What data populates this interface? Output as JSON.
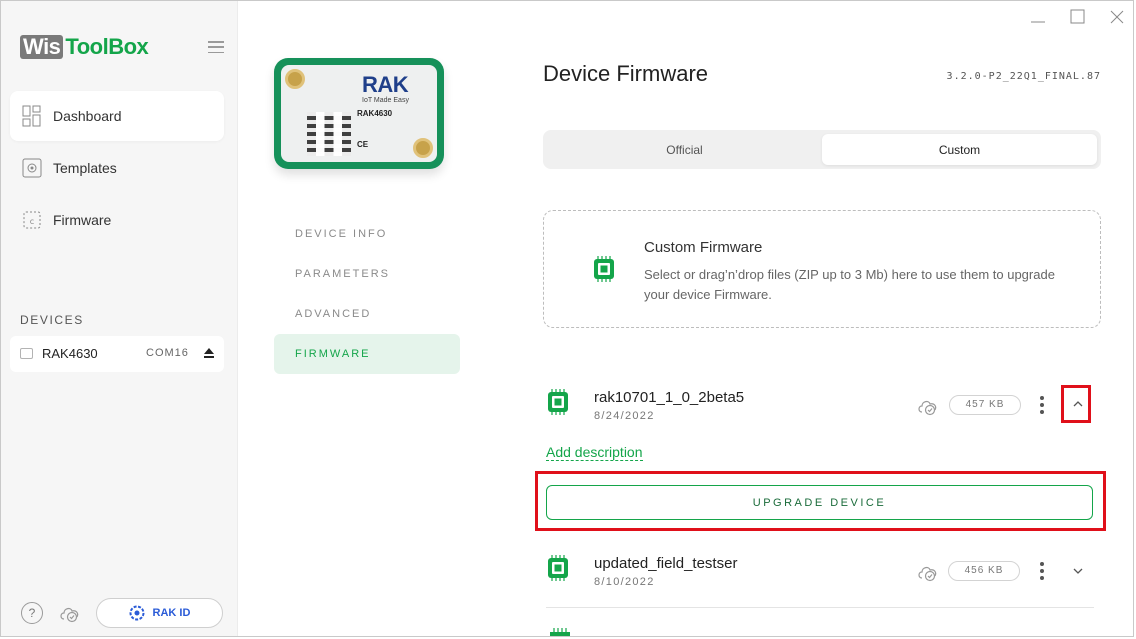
{
  "app": {
    "logo_part1": "Wis",
    "logo_part2": "ToolBox"
  },
  "window": {
    "minimize": "—",
    "maximize": "□",
    "close": "✕"
  },
  "sidebar": {
    "nav": [
      {
        "label": "Dashboard",
        "icon": "dashboard-icon",
        "active": true
      },
      {
        "label": "Templates",
        "icon": "templates-icon",
        "active": false
      },
      {
        "label": "Firmware",
        "icon": "firmware-icon",
        "active": false
      }
    ],
    "devices_title": "DEVICES",
    "device": {
      "name": "RAK4630",
      "port": "COM16"
    },
    "help": "?",
    "rak_id": "RAK ID"
  },
  "module": {
    "brand": "RAK",
    "slogan": "IoT Made Easy",
    "model": "RAK4630"
  },
  "device_menu": [
    {
      "label": "DEVICE INFO",
      "active": false
    },
    {
      "label": "PARAMETERS",
      "active": false
    },
    {
      "label": "ADVANCED",
      "active": false
    },
    {
      "label": "FIRMWARE",
      "active": true
    }
  ],
  "main": {
    "title": "Device Firmware",
    "version": "3.2.0-P2_22Q1_FINAL.87",
    "tabs": [
      {
        "label": "Official",
        "selected": false
      },
      {
        "label": "Custom",
        "selected": true
      }
    ],
    "dropzone": {
      "title": "Custom Firmware",
      "description": "Select or drag’n’drop files (ZIP up to 3 Mb) here to use them to upgrade your device Firmware."
    },
    "firmwares": [
      {
        "name": "rak10701_1_0_2beta5",
        "date": "8/24/2022",
        "size": "457 KB",
        "expanded": true
      },
      {
        "name": "updated_field_testser",
        "date": "8/10/2022",
        "size": "456 KB",
        "expanded": false
      }
    ],
    "add_description": "Add description",
    "upgrade_button": "UPGRADE DEVICE"
  },
  "colors": {
    "accent": "#14a54a",
    "highlight": "#e0101a",
    "rak_id": "#2a5bd7"
  }
}
